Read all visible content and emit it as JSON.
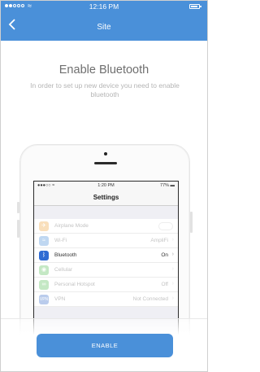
{
  "status_bar": {
    "time": "12:16 PM"
  },
  "header": {
    "title": "Site"
  },
  "main": {
    "heading": "Enable Bluetooth",
    "subtitle": "In order to set up new device you need to enable bluetooth"
  },
  "illustration": {
    "status_time": "1:20 PM",
    "status_battery": "77%",
    "nav_title": "Settings",
    "rows": [
      {
        "label": "Airplane Mode",
        "value": "",
        "icon": "airplane-icon",
        "color": "#f0a640"
      },
      {
        "label": "Wi-Fi",
        "value": "AmpliFi",
        "icon": "wifi-icon",
        "color": "#4a90d9"
      },
      {
        "label": "Bluetooth",
        "value": "On",
        "icon": "bluetooth-icon",
        "color": "#2f6bd3"
      },
      {
        "label": "Cellular",
        "value": "",
        "icon": "cellular-icon",
        "color": "#5ac05a"
      },
      {
        "label": "Personal Hotspot",
        "value": "Off",
        "icon": "hotspot-icon",
        "color": "#5ac05a"
      },
      {
        "label": "VPN",
        "value": "Not Connected",
        "icon": "vpn-icon",
        "color": "#3b6fc9"
      }
    ]
  },
  "footer": {
    "enable_label": "ENABLE"
  },
  "colors": {
    "accent": "#4a90d9"
  }
}
